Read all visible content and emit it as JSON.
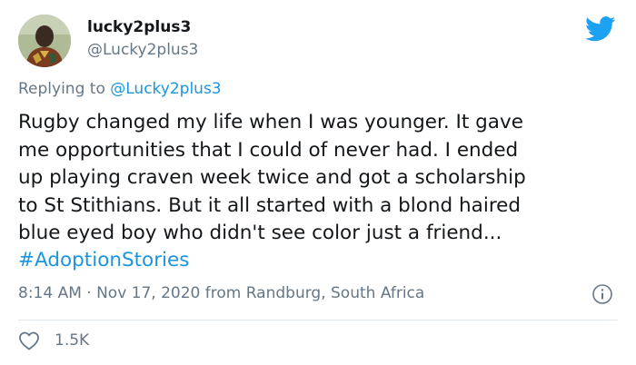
{
  "tweet": {
    "display_name": "lucky2plus3",
    "handle": "@Lucky2plus3",
    "reply_prefix": "Replying to ",
    "reply_to": "@Lucky2plus3",
    "text": "Rugby changed my life when I was younger. It gave\nme opportunities that I could of never had. I ended\nup playing craven week twice and got a scholarship\nto St Stithians. But it all started with a blond haired\nblue eyed boy who didn't see color just a friend...",
    "hashtag": "#AdoptionStories",
    "timestamp": "8:14 AM · Nov 17, 2020 from Randburg, South Africa",
    "likes": "1.5K"
  },
  "icons": {
    "brand": "twitter-bird-icon",
    "info": "info-icon",
    "like": "heart-icon"
  },
  "colors": {
    "accent": "#1da1f2",
    "link": "#1b95e0",
    "secondary_text": "#657786",
    "primary_text": "#14171a"
  }
}
